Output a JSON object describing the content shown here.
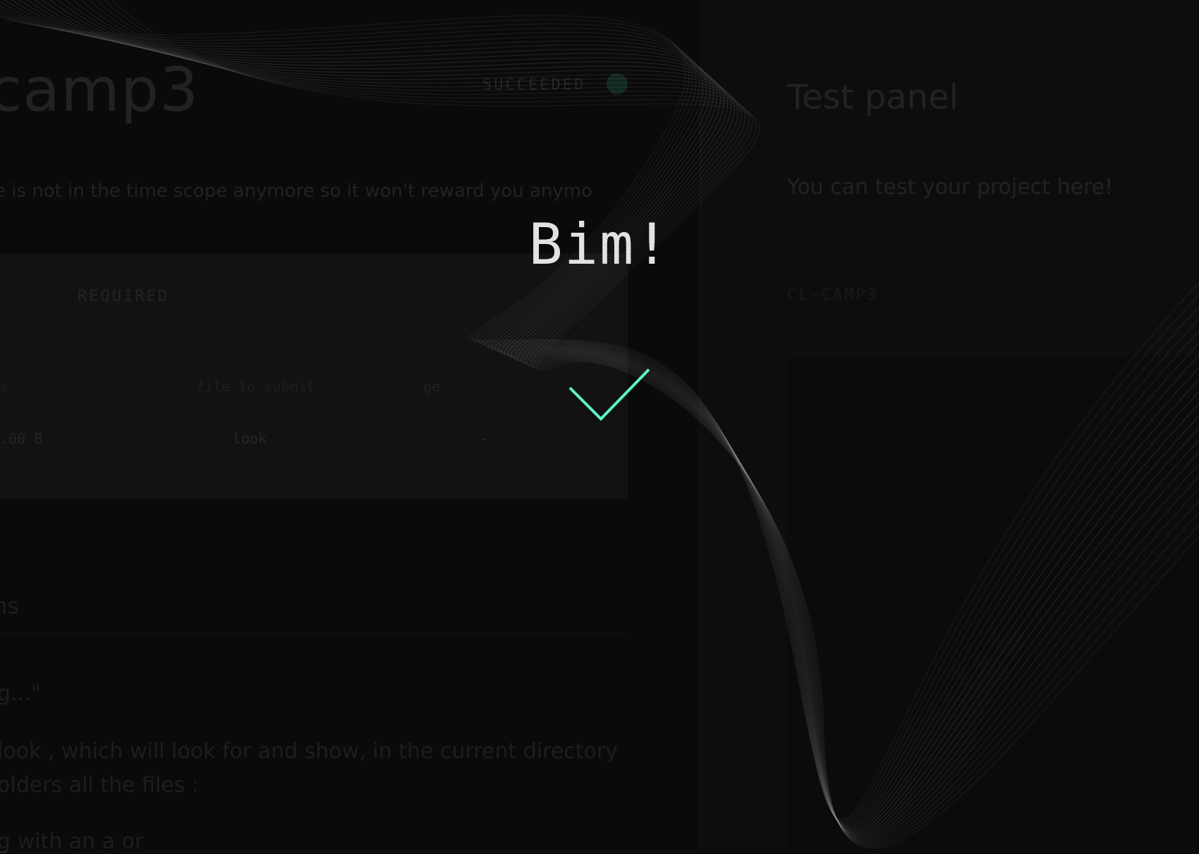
{
  "project": {
    "title": "camp3",
    "status": "SUCCEEDED",
    "status_color": "#143126",
    "notice": "e is not in the time scope anymore so it won't reward you anymo",
    "requirements": {
      "label": "REQUIRED",
      "columns": [
        "s",
        "file to submit",
        "ge"
      ],
      "row": [
        ".00 B",
        "look",
        "-"
      ]
    },
    "instructions": {
      "heading": "ns",
      "lines": [
        "g...\"",
        " look , which will look for and show, in the current directory",
        "olders all the files :",
        "g with an  a  or"
      ]
    }
  },
  "test_panel": {
    "title": "Test panel",
    "subtitle": "You can test your project here!",
    "tag": "CL-CAMP3"
  },
  "modal": {
    "title": "Bim!",
    "icon": "check-icon",
    "accent": "#5ef2c8"
  }
}
